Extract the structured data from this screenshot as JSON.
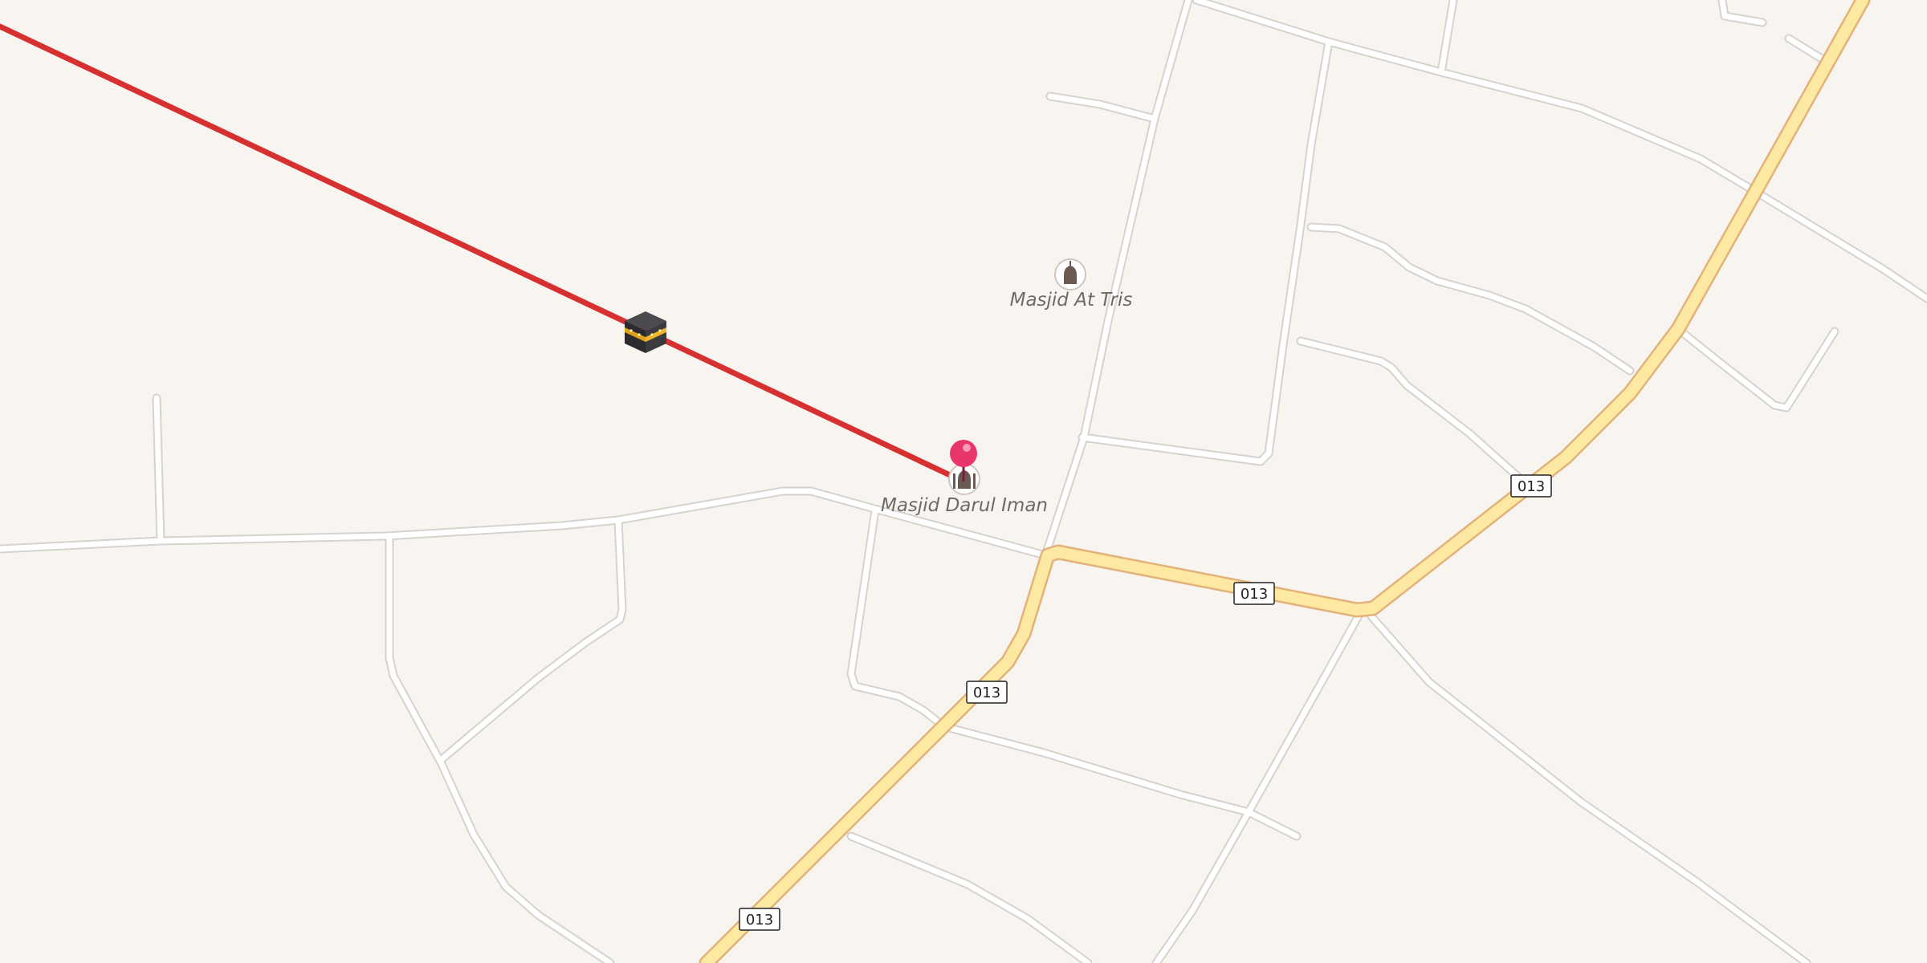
{
  "map": {
    "background": "#f8f5f1",
    "route_number": "013",
    "pois": [
      {
        "name": "Masjid At Tris",
        "icon": "mosque-icon"
      },
      {
        "name": "Masjid Darul Iman",
        "icon": "mosque-icon"
      }
    ],
    "qibla_line": {
      "color": "#d63031",
      "marker_icon": "kaaba-icon"
    },
    "location_pin": {
      "color": "#e8366b",
      "icon": "location-pin-icon"
    },
    "colors": {
      "minor_road": "#ffffff",
      "minor_road_casing": "#d9d5d0",
      "primary_road": "#fde9a2",
      "primary_road_casing": "#e7b77d"
    }
  }
}
